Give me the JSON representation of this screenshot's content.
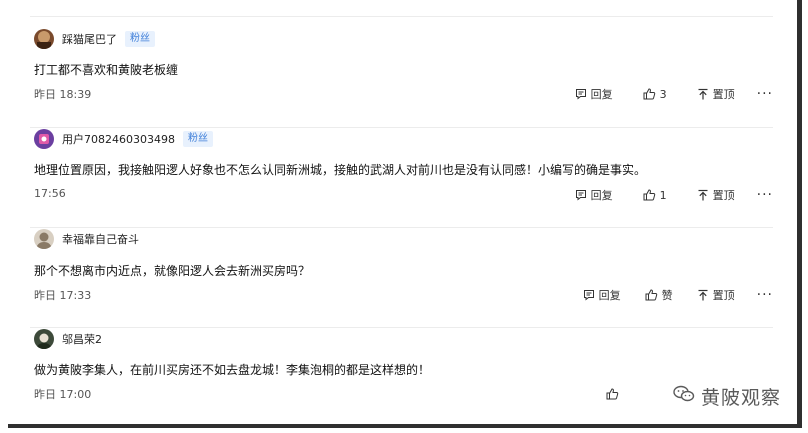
{
  "comments": [
    {
      "username": "踩猫尾巴了",
      "badge": "粉丝",
      "text": "打工都不喜欢和黄陂老板缠",
      "time": "昨日 18:39",
      "reply_label": "回复",
      "like_label": "3",
      "pin_label": "置顶",
      "more_label": "···"
    },
    {
      "username": "用户7082460303498",
      "badge": "粉丝",
      "text": "地理位置原因，我接触阳逻人好象也不怎么认同新洲城，接触的武湖人对前川也是没有认同感！小编写的确是事实。",
      "time": "17:56",
      "reply_label": "回复",
      "like_label": "1",
      "pin_label": "置顶",
      "more_label": "···"
    },
    {
      "username": "幸福靠自己奋斗",
      "badge": "",
      "text": "那个不想离市内近点，就像阳逻人会去新洲买房吗？",
      "time": "昨日 17:33",
      "reply_label": "回复",
      "like_label": "赞",
      "pin_label": "置顶",
      "more_label": "···"
    },
    {
      "username": "邬昌荣2",
      "badge": "",
      "text": "做为黄陂李集人，在前川买房还不如去盘龙城！李集泡桐的都是这样想的！",
      "time": "昨日 17:00",
      "reply_label": "",
      "like_label": "",
      "pin_label": "",
      "more_label": ""
    }
  ],
  "watermark": {
    "text": "黄陂观察"
  },
  "colors": {
    "badge_bg": "#e8f1fd",
    "badge_text": "#3f7fd9",
    "frame_shadow": "#2f2f2f",
    "divider": "#ececec"
  }
}
